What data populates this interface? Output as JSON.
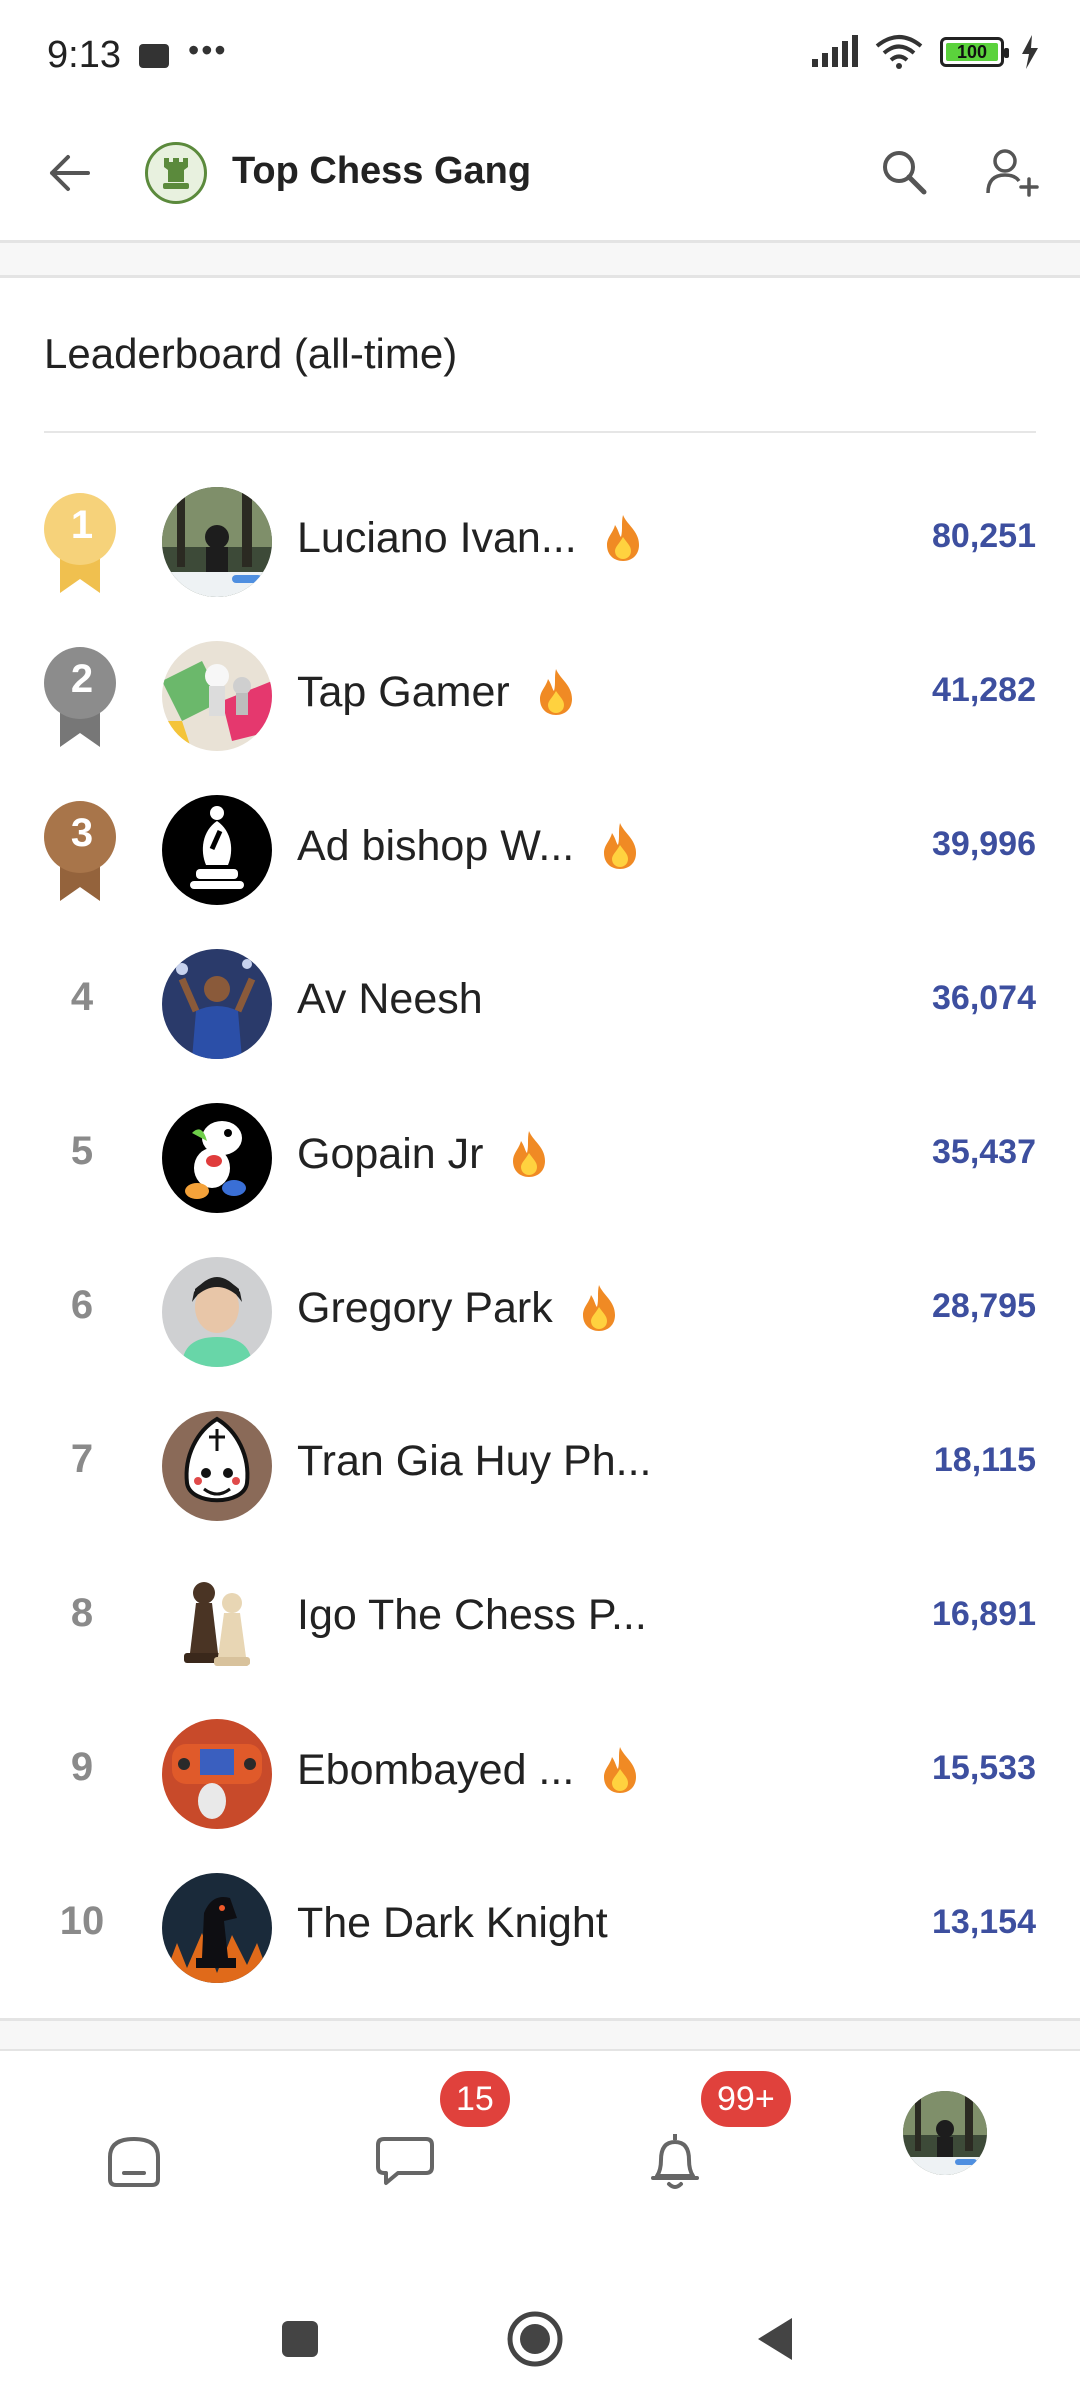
{
  "status_bar": {
    "time": "9:13",
    "dots": "•••",
    "battery": "100"
  },
  "header": {
    "title": "Top Chess Gang"
  },
  "section_title": "Leaderboard (all-time)",
  "leaderboard": [
    {
      "rank": "1",
      "name": "Luciano Ivan...",
      "score": "80,251",
      "fire": true,
      "medal": "gold"
    },
    {
      "rank": "2",
      "name": "Tap Gamer",
      "score": "41,282",
      "fire": true,
      "medal": "silver"
    },
    {
      "rank": "3",
      "name": "Ad bishop W...",
      "score": "39,996",
      "fire": true,
      "medal": "bronze"
    },
    {
      "rank": "4",
      "name": "Av Neesh",
      "score": "36,074",
      "fire": false,
      "medal": ""
    },
    {
      "rank": "5",
      "name": "Gopain Jr",
      "score": "35,437",
      "fire": true,
      "medal": ""
    },
    {
      "rank": "6",
      "name": "Gregory Park",
      "score": "28,795",
      "fire": true,
      "medal": ""
    },
    {
      "rank": "7",
      "name": "Tran Gia Huy Ph...",
      "score": "18,115",
      "fire": false,
      "medal": ""
    },
    {
      "rank": "8",
      "name": "Igo The Chess P...",
      "score": "16,891",
      "fire": false,
      "medal": ""
    },
    {
      "rank": "9",
      "name": "Ebombayed ...",
      "score": "15,533",
      "fire": true,
      "medal": ""
    },
    {
      "rank": "10",
      "name": "The Dark Knight",
      "score": "13,154",
      "fire": false,
      "medal": ""
    }
  ],
  "bottom_nav": {
    "messages_badge": "15",
    "notifications_badge": "99+"
  },
  "colors": {
    "score": "#3d4f9f",
    "gold": "#f6d27a",
    "silver": "#8c8c8c",
    "bronze": "#a8754a",
    "fire": "#f08a24",
    "badge": "#e0413c"
  },
  "icons": {
    "back": "arrow-left-icon",
    "search": "search-icon",
    "add_member": "add-person-icon",
    "home": "home-icon",
    "chat": "chat-icon",
    "bell": "bell-icon"
  }
}
